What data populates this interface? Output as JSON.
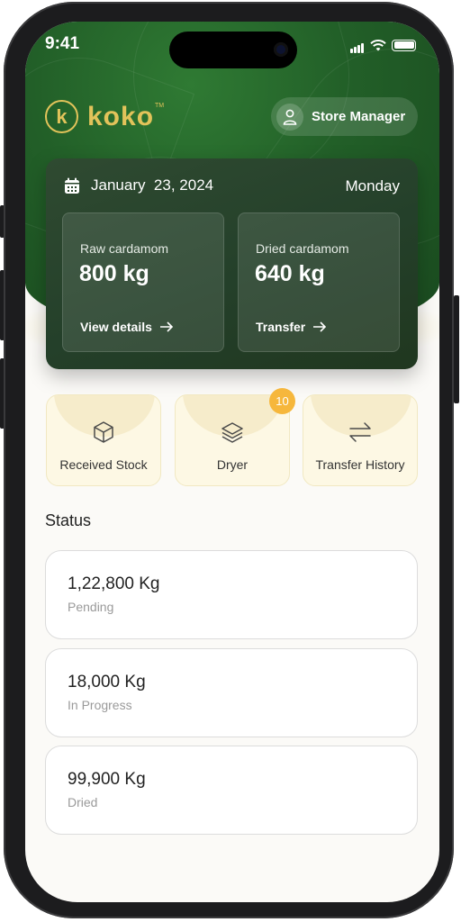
{
  "status_bar": {
    "time": "9:41"
  },
  "brand": {
    "name": "koko",
    "mark": "k",
    "tm": "TM"
  },
  "header": {
    "user_role": "Store Manager"
  },
  "summary": {
    "date": "January  23, 2024",
    "day": "Monday",
    "tiles": [
      {
        "label": "Raw cardamom",
        "value": "800 kg",
        "link": "View details"
      },
      {
        "label": "Dried cardamom",
        "value": "640 kg",
        "link": "Transfer"
      }
    ]
  },
  "actions": [
    {
      "label": "Received Stock",
      "icon": "cube-icon"
    },
    {
      "label": "Dryer",
      "icon": "layers-icon",
      "badge": "10"
    },
    {
      "label": "Transfer History",
      "icon": "transfer-arrows-icon"
    }
  ],
  "status": {
    "title": "Status",
    "items": [
      {
        "value": "1,22,800 Kg",
        "label": "Pending"
      },
      {
        "value": "18,000 Kg",
        "label": "In Progress"
      },
      {
        "value": "99,900 Kg",
        "label": "Dried"
      }
    ]
  },
  "colors": {
    "brand_green": "#225f28",
    "gold": "#e2c35a",
    "badge": "#f6b73c",
    "tile_cream": "#fdf8e4"
  }
}
